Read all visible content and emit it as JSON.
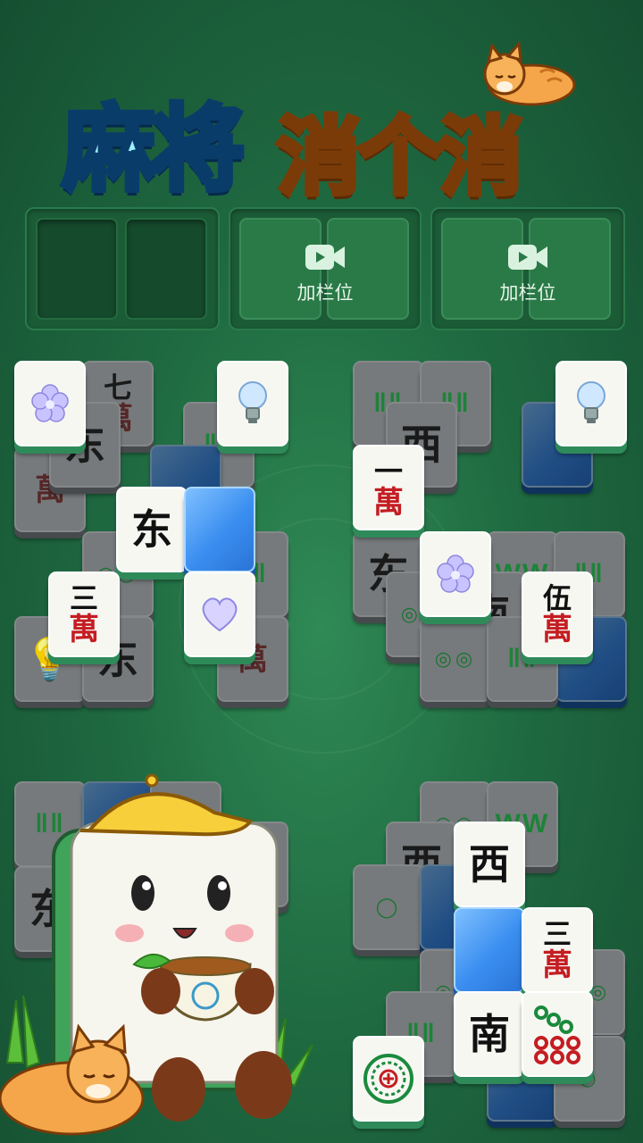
{
  "title": {
    "part1": "麻将",
    "part2": "消个消"
  },
  "slot_bar": {
    "add_slot_label": "加栏位"
  },
  "colors": {
    "background": "#1f6a41",
    "tile_face": "#f7f7f2",
    "wan_red": "#c41d22",
    "title_blue": "#9ff0ff",
    "title_gold": "#ffd64a"
  },
  "tiles": {
    "t01": "七",
    "t02": "萬",
    "t03": "东",
    "t04": "萬",
    "t05": "东",
    "t06": "三",
    "t07": "萬",
    "t08": "东",
    "t09": "萬",
    "t10": "西",
    "t11": "一",
    "t12": "萬",
    "t13": "东",
    "t14": "南",
    "t15": "伍",
    "t16": "萬",
    "t17": "西",
    "t18": "三",
    "t19": "萬",
    "t20": "南",
    "t21": "萬",
    "t22": "东",
    "t23": "西"
  }
}
